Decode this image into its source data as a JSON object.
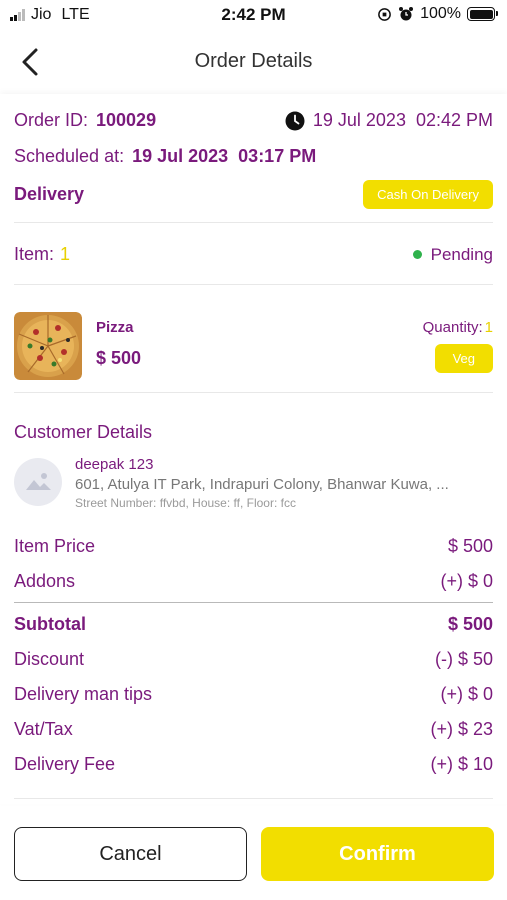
{
  "status_bar": {
    "carrier": "Jio",
    "network": "LTE",
    "time": "2:42 PM",
    "battery": "100%"
  },
  "header": {
    "title": "Order Details",
    "back_icon": "chevron-left-icon"
  },
  "order": {
    "id_label": "Order ID:",
    "id_value": "100029",
    "date": "19 Jul 2023  02:42 PM",
    "scheduled_label": "Scheduled at:",
    "scheduled_value": "19 Jul 2023  03:17 PM",
    "type": "Delivery",
    "payment_badge": "Cash On Delivery",
    "item_label": "Item:",
    "item_count": "1",
    "status": "Pending"
  },
  "product": {
    "name": "Pizza",
    "price": "$ 500",
    "quantity_label": "Quantity:",
    "quantity_value": "1",
    "tag": "Veg"
  },
  "customer": {
    "section_title": "Customer Details",
    "name": "deepak 123",
    "address": "601, Atulya IT Park, Indrapuri Colony, Bhanwar Kuwa, ...",
    "street_info": "Street Number: ffvbd, House: ff, Floor: fcc"
  },
  "summary": {
    "item_price_label": "Item Price",
    "item_price": "$ 500",
    "addons_label": "Addons",
    "addons": "(+) $ 0",
    "subtotal_label": "Subtotal",
    "subtotal": "$ 500",
    "discount_label": "Discount",
    "discount": "(-) $ 50",
    "tips_label": "Delivery man tips",
    "tips": "(+) $ 0",
    "vat_label": "Vat/Tax",
    "vat": "(+) $ 23",
    "delivery_fee_label": "Delivery Fee",
    "delivery_fee": "(+) $ 10"
  },
  "actions": {
    "cancel": "Cancel",
    "confirm": "Confirm"
  },
  "colors": {
    "accent_purple": "#7a1a7c",
    "accent_yellow": "#f2de00",
    "status_green": "#2fb24c"
  }
}
